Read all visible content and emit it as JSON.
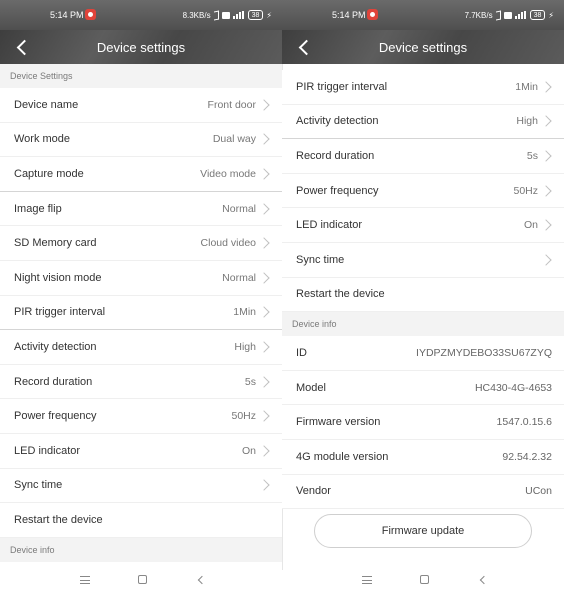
{
  "left": {
    "status": {
      "time": "5:14 PM",
      "speed": "8.3KB/s",
      "battery": "38"
    },
    "header": {
      "title": "Device settings"
    },
    "section_title": "Device Settings",
    "rows": [
      {
        "label": "Device name",
        "value": "Front door"
      },
      {
        "label": "Work mode",
        "value": "Dual way"
      },
      {
        "label": "Capture mode",
        "value": "Video mode"
      },
      {
        "label": "Image flip",
        "value": "Normal"
      },
      {
        "label": "SD Memory card",
        "value": "Cloud video"
      },
      {
        "label": "Night vision mode",
        "value": "Normal"
      },
      {
        "label": "PIR trigger interval",
        "value": "1Min"
      },
      {
        "label": "Activity detection",
        "value": "High"
      },
      {
        "label": "Record duration",
        "value": "5s"
      },
      {
        "label": "Power frequency",
        "value": "50Hz"
      },
      {
        "label": "LED indicator",
        "value": "On"
      },
      {
        "label": "Sync time",
        "value": ""
      },
      {
        "label": "Restart the device"
      }
    ],
    "footer_section": "Device info"
  },
  "right": {
    "status": {
      "time": "5:14 PM",
      "speed": "7.7KB/s",
      "battery": "38"
    },
    "header": {
      "title": "Device settings"
    },
    "rows": [
      {
        "label": "PIR trigger interval",
        "value": "1Min"
      },
      {
        "label": "Activity detection",
        "value": "High"
      },
      {
        "label": "Record duration",
        "value": "5s"
      },
      {
        "label": "Power frequency",
        "value": "50Hz"
      },
      {
        "label": "LED indicator",
        "value": "On"
      },
      {
        "label": "Sync time",
        "value": ""
      },
      {
        "label": "Restart the device"
      }
    ],
    "info_section": "Device info",
    "info_rows": [
      {
        "label": "ID",
        "value": "IYDPZMYDEBO33SU67ZYQ"
      },
      {
        "label": "Model",
        "value": "HC430-4G-4653"
      },
      {
        "label": "Firmware version",
        "value": "1547.0.15.6"
      },
      {
        "label": "4G module version",
        "value": "92.54.2.32"
      },
      {
        "label": "Vendor",
        "value": "UCon"
      }
    ],
    "firmware_button": "Firmware update"
  },
  "icons": {
    "back": "back-arrow-icon",
    "chevron": "chevron-right-icon",
    "alert": "notification-alert-icon",
    "nav_menu": "nav-menu-icon",
    "nav_home": "nav-home-icon",
    "nav_back": "nav-back-icon"
  },
  "colors": {
    "header_bg": "#4c4c4c",
    "section_bg": "#f3f3f3",
    "accent_alert": "#e0433a"
  }
}
